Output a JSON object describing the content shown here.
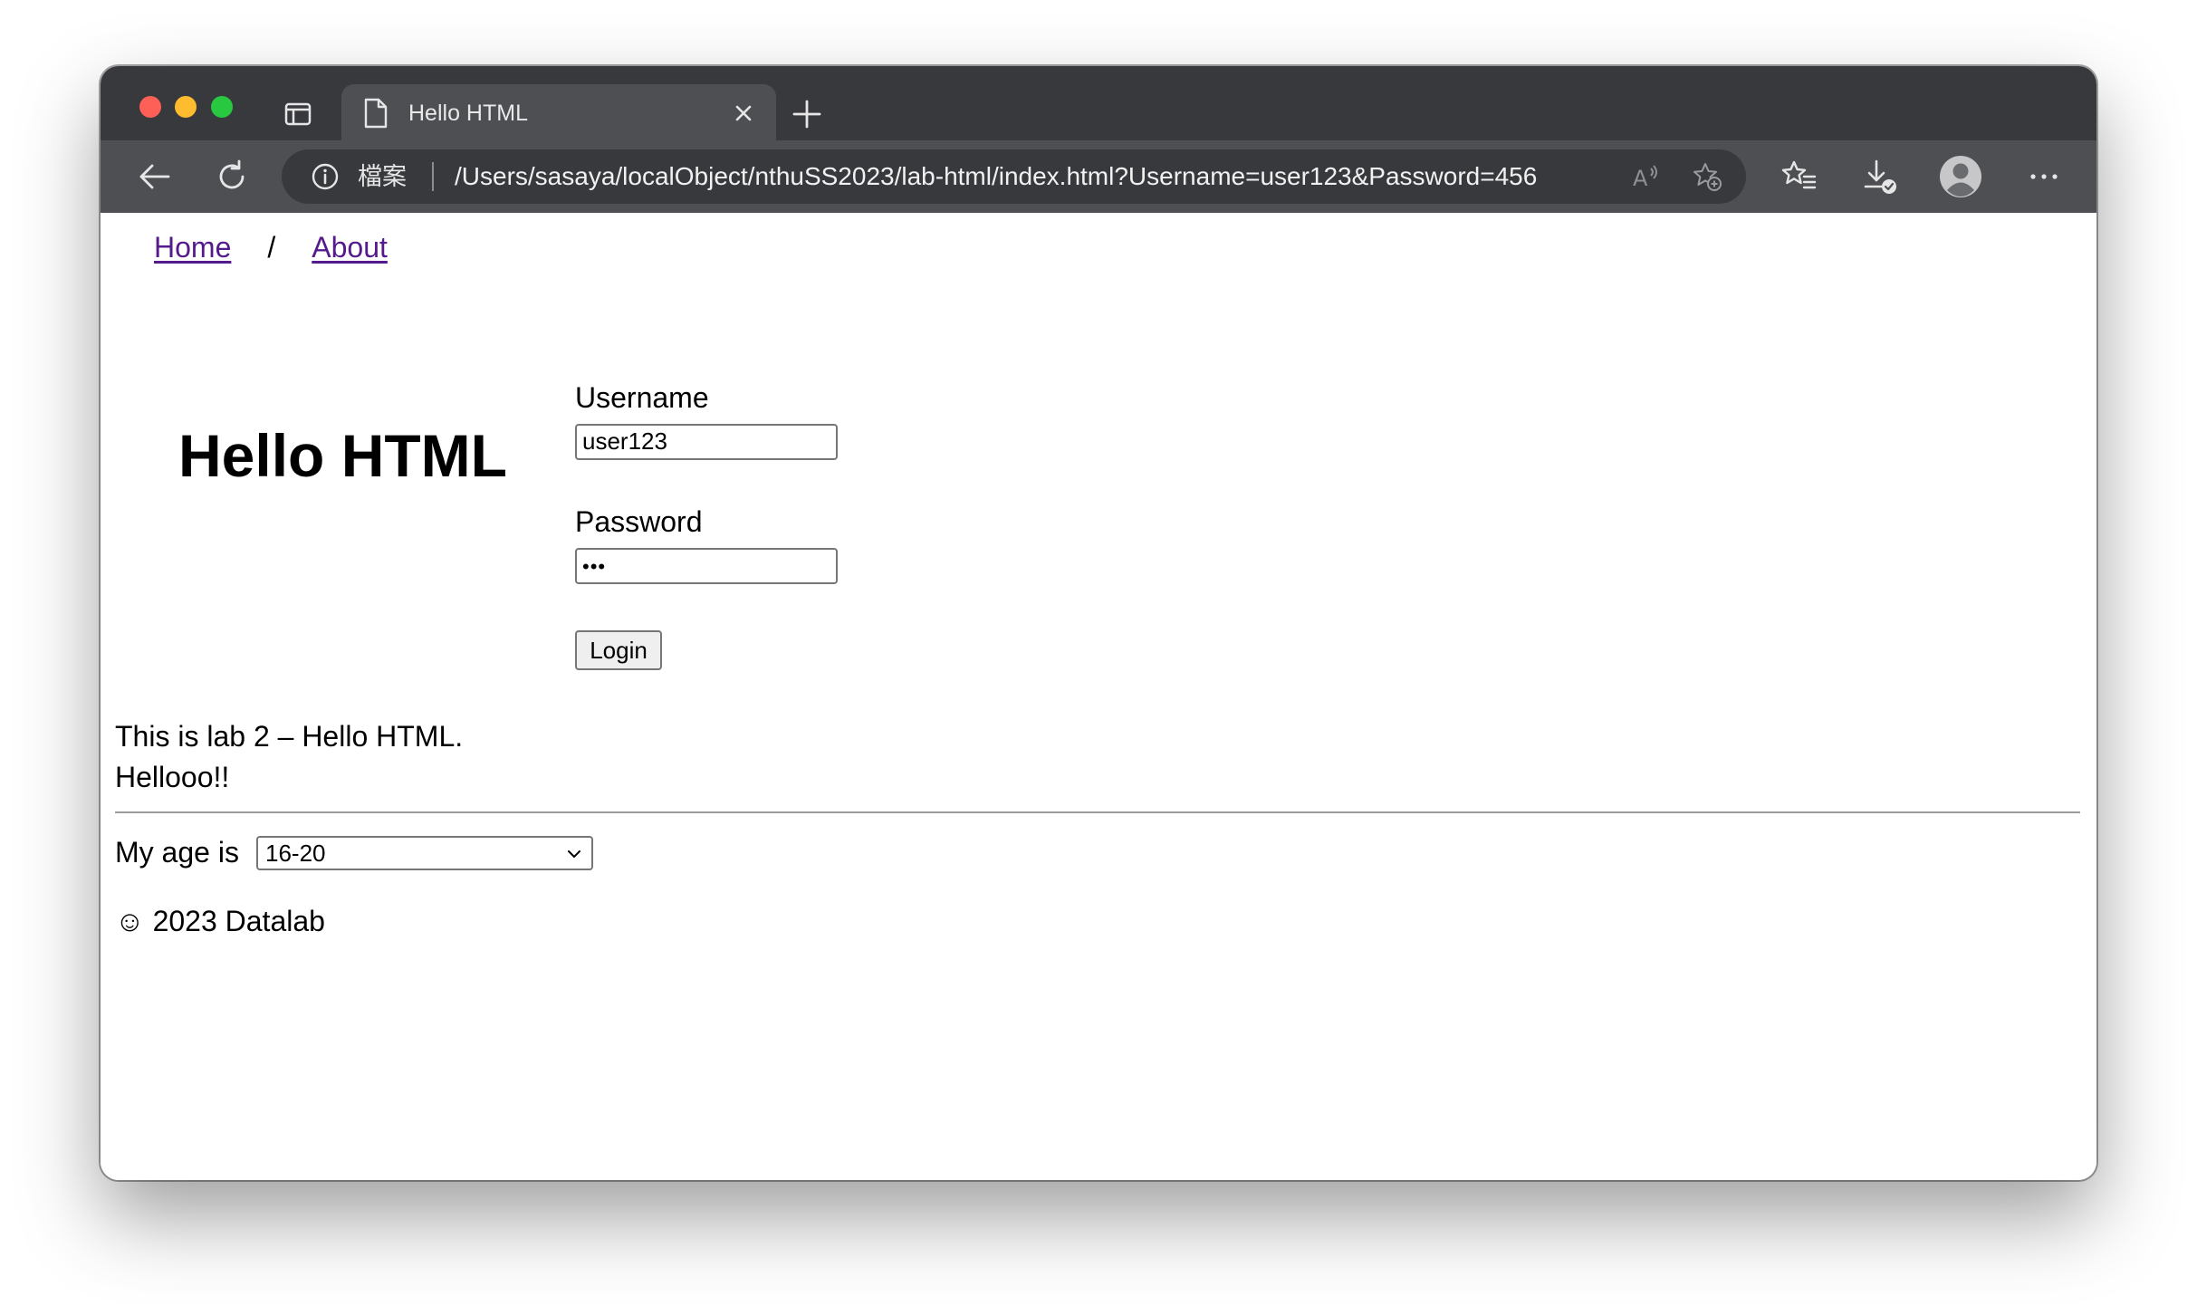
{
  "browser": {
    "tab": {
      "title": "Hello HTML"
    },
    "address_bar": {
      "scheme_label": "檔案",
      "url": "/Users/sasaya/localObject/nthuSS2023/lab-html/index.html?Username=user123&Password=456"
    }
  },
  "page": {
    "nav": {
      "home_label": "Home",
      "separator": "/",
      "about_label": "About"
    },
    "hero": {
      "title": "Hello HTML"
    },
    "form": {
      "username_label": "Username",
      "username_value": "user123",
      "password_label": "Password",
      "password_value": "•••",
      "login_label": "Login"
    },
    "text": {
      "line1": "This is lab 2 – Hello HTML.",
      "line2": "Hellooo!!"
    },
    "age": {
      "label": "My age is",
      "selected": "16-20"
    },
    "footer": {
      "text": "☺ 2023 Datalab"
    }
  },
  "colors": {
    "link": "#551a8b",
    "tabstrip": "#38393d",
    "toolbar": "#4e4f53",
    "close_button": "#fe5f57",
    "minimize_button": "#febc2e",
    "zoom_button": "#28c840"
  }
}
